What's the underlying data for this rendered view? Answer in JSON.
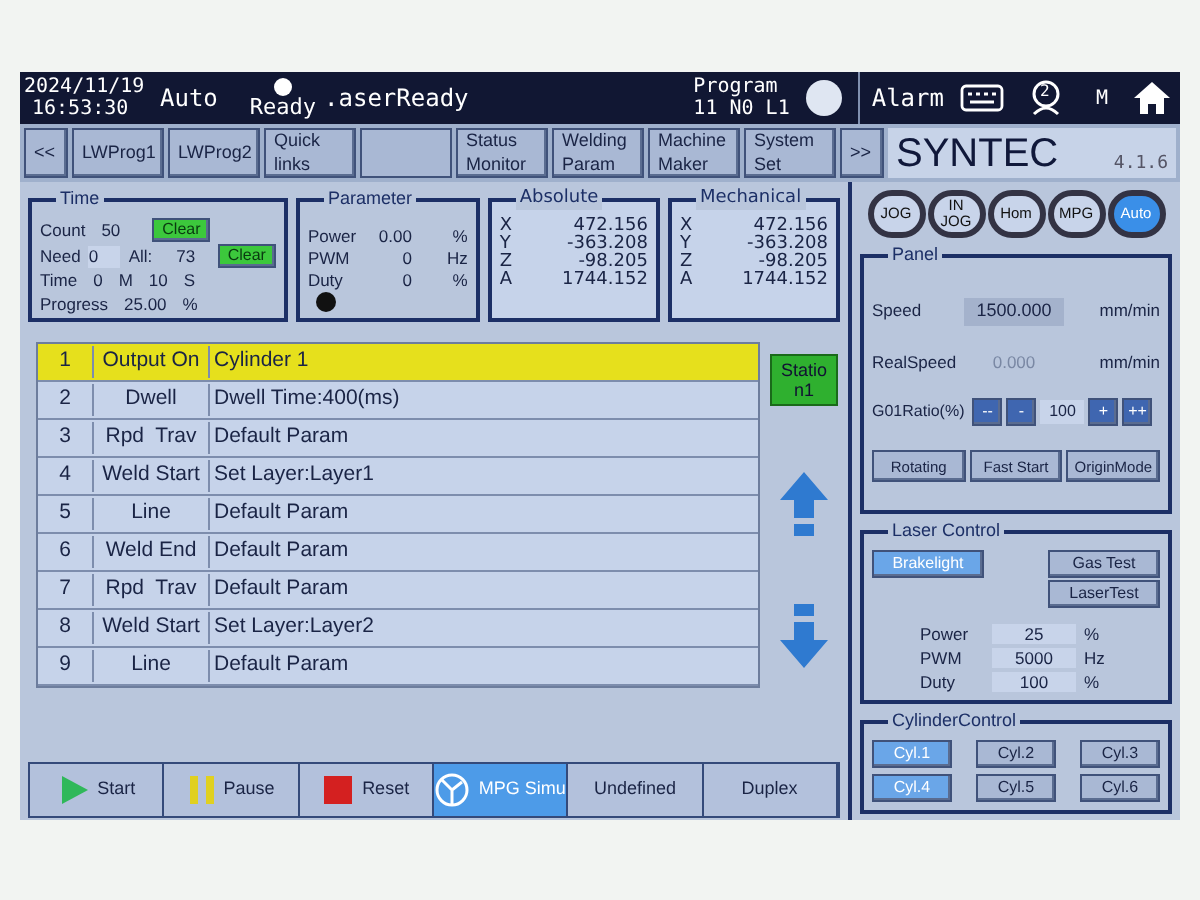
{
  "status_bar": {
    "date": "2024/11/19",
    "time": "16:53:30",
    "mode": "Auto",
    "state": "Ready",
    "laser_state": ".aserReady",
    "program_label": "Program",
    "program_line": "11 N0 L1",
    "alarm": "Alarm",
    "user_count": "2",
    "m_label": "M"
  },
  "nav": {
    "buttons": [
      {
        "kind": "text",
        "label": "<<"
      },
      {
        "kind": "text",
        "label": "LWProg1"
      },
      {
        "kind": "text",
        "label": "LWProg2"
      },
      {
        "kind": "text",
        "label": "Quick links"
      },
      {
        "kind": "blank"
      },
      {
        "kind": "text",
        "label": "Status Monitor"
      },
      {
        "kind": "text",
        "label": "Welding Param"
      },
      {
        "kind": "text",
        "label": "Machine Maker"
      },
      {
        "kind": "text",
        "label": "System Set"
      },
      {
        "kind": "text",
        "label": ">>"
      }
    ],
    "brand": "SYNTEC",
    "version": "4.1.6"
  },
  "time_box": {
    "title": "Time",
    "count_label": "Count",
    "count": "50",
    "clear": "Clear",
    "need_label": "Need",
    "need": "0",
    "all_label": "All:",
    "all": "73",
    "clear2": "Clear",
    "time_label": "Time",
    "minutes": "0",
    "m": "M",
    "seconds": "10",
    "s": "S",
    "progress_label": "Progress",
    "progress": "25.00",
    "progress_unit": "%"
  },
  "parameter": {
    "title": "Parameter",
    "rows": [
      {
        "label": "Power",
        "value": "0.00",
        "unit": "%"
      },
      {
        "label": "PWM",
        "value": "0",
        "unit": "Hz"
      },
      {
        "label": "Duty",
        "value": "0",
        "unit": "%"
      }
    ]
  },
  "coords": [
    {
      "title": "Absolute",
      "axes": [
        {
          "axis": "X",
          "value": "472.156"
        },
        {
          "axis": "Y",
          "value": "-363.208"
        },
        {
          "axis": "Z",
          "value": "-98.205"
        },
        {
          "axis": "A",
          "value": "1744.152"
        }
      ]
    },
    {
      "title": "Mechanical",
      "axes": [
        {
          "axis": "X",
          "value": "472.156"
        },
        {
          "axis": "Y",
          "value": "-363.208"
        },
        {
          "axis": "Z",
          "value": "-98.205"
        },
        {
          "axis": "A",
          "value": "1744.152"
        }
      ]
    }
  ],
  "program_rows": [
    {
      "no": "1",
      "command": "Output On",
      "detail": "Cylinder 1",
      "selected": true
    },
    {
      "no": "2",
      "command": "Dwell",
      "detail": "Dwell Time:400(ms)",
      "selected": false
    },
    {
      "no": "3",
      "command": "Rpd  Trav",
      "detail": "Default Param",
      "selected": false
    },
    {
      "no": "4",
      "command": "Weld Start",
      "detail": "Set Layer:Layer1",
      "selected": false
    },
    {
      "no": "5",
      "command": "Line",
      "detail": "Default Param",
      "selected": false
    },
    {
      "no": "6",
      "command": "Weld End",
      "detail": "Default Param",
      "selected": false
    },
    {
      "no": "7",
      "command": "Rpd  Trav",
      "detail": "Default Param",
      "selected": false
    },
    {
      "no": "8",
      "command": "Weld Start",
      "detail": "Set Layer:Layer2",
      "selected": false
    },
    {
      "no": "9",
      "command": "Line",
      "detail": "Default Param",
      "selected": false
    }
  ],
  "station": "Station1",
  "bottom_buttons": [
    {
      "label": "Start",
      "kind": "start",
      "selected": false
    },
    {
      "label": "Pause",
      "kind": "pause",
      "selected": false
    },
    {
      "label": "Reset",
      "kind": "reset",
      "selected": false
    },
    {
      "label": "MPG Simu",
      "kind": "mpg",
      "selected": true
    },
    {
      "label": "Undefined",
      "kind": "plain",
      "selected": false
    },
    {
      "label": "Duplex",
      "kind": "plain",
      "selected": false
    }
  ],
  "modes": [
    {
      "label": "JOG",
      "selected": false
    },
    {
      "label": "IN JOG",
      "selected": false
    },
    {
      "label": "Hom",
      "selected": false
    },
    {
      "label": "MPG",
      "selected": false
    },
    {
      "label": "Auto",
      "selected": true
    }
  ],
  "panel": {
    "title": "Panel",
    "speed_label": "Speed",
    "speed": "1500.000",
    "speed_unit": "mm/min",
    "real_label": "RealSpeed",
    "real": "0.000",
    "real_unit": "mm/min",
    "ratio_label": "G01Ratio(%)",
    "ratio_buttons": [
      "--",
      "-"
    ],
    "ratio": "100",
    "ratio_buttons2": [
      "+",
      "++"
    ],
    "actions": [
      "Rotating",
      "Fast Start",
      "OriginMode"
    ]
  },
  "laser": {
    "title": "Laser Control",
    "buttons": [
      {
        "label": "Brakelight",
        "selected": true
      },
      {
        "label": "Gas Test",
        "selected": false
      },
      {
        "label": "LaserTest",
        "selected": false
      }
    ],
    "rows": [
      {
        "label": "Power",
        "value": "25",
        "unit": "%"
      },
      {
        "label": "PWM",
        "value": "5000",
        "unit": "Hz"
      },
      {
        "label": "Duty",
        "value": "100",
        "unit": "%"
      }
    ]
  },
  "cylinders": {
    "title": "CylinderControl",
    "items": [
      {
        "label": "Cyl.1",
        "selected": true
      },
      {
        "label": "Cyl.2",
        "selected": false
      },
      {
        "label": "Cyl.3",
        "selected": false
      },
      {
        "label": "Cyl.4",
        "selected": true
      },
      {
        "label": "Cyl.5",
        "selected": false
      },
      {
        "label": "Cyl.6",
        "selected": false
      }
    ]
  }
}
